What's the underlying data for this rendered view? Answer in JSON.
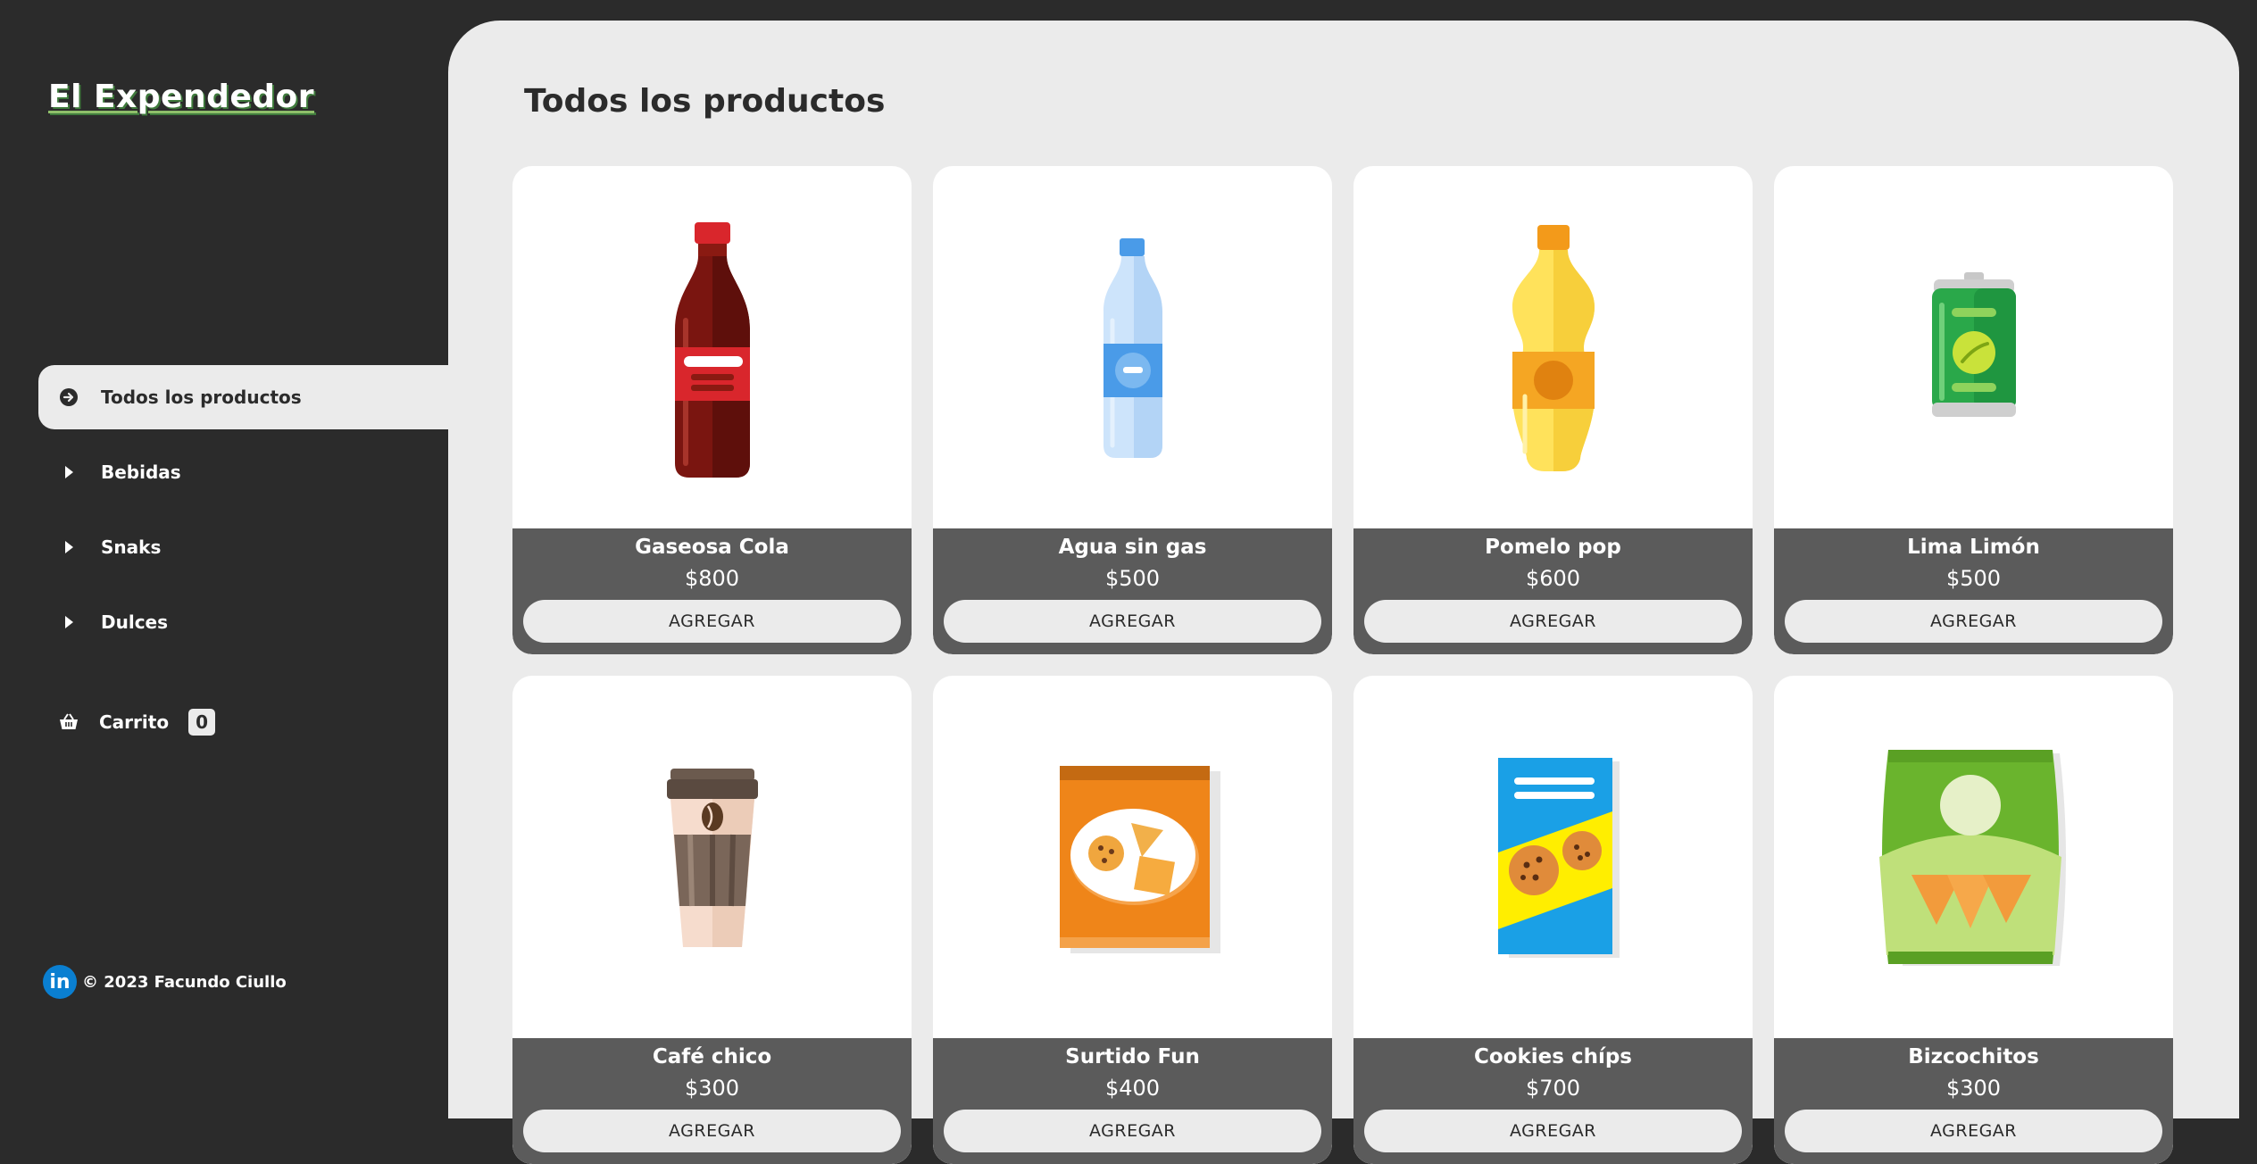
{
  "brand": {
    "title": "El Expendedor"
  },
  "sidebar": {
    "items": [
      {
        "label": "Todos los productos",
        "icon": "arrow-circle-right-icon",
        "active": true
      },
      {
        "label": "Bebidas",
        "icon": "caret-right-icon"
      },
      {
        "label": "Snaks",
        "icon": "caret-right-icon"
      },
      {
        "label": "Dulces",
        "icon": "caret-right-icon"
      }
    ],
    "cart": {
      "label": "Carrito",
      "count": "0",
      "icon": "basket-icon"
    },
    "footer": {
      "text": "© 2023 Facundo Ciullo",
      "icon": "linkedin-icon",
      "icon_glyph": "in"
    }
  },
  "main": {
    "title": "Todos los productos",
    "products": [
      {
        "name": "Gaseosa Cola",
        "price": "$800",
        "button": "AGREGAR",
        "icon": "cola-bottle-icon"
      },
      {
        "name": "Agua sin gas",
        "price": "$500",
        "button": "AGREGAR",
        "icon": "water-bottle-icon"
      },
      {
        "name": "Pomelo pop",
        "price": "$600",
        "button": "AGREGAR",
        "icon": "grapefruit-soda-bottle-icon"
      },
      {
        "name": "Lima Limón",
        "price": "$500",
        "button": "AGREGAR",
        "icon": "lime-can-icon"
      },
      {
        "name": "Café chico",
        "price": "$300",
        "button": "AGREGAR",
        "icon": "coffee-cup-icon"
      },
      {
        "name": "Surtido Fun",
        "price": "$400",
        "button": "AGREGAR",
        "icon": "assorted-crackers-box-icon"
      },
      {
        "name": "Cookies chíps",
        "price": "$700",
        "button": "AGREGAR",
        "icon": "cookies-box-icon"
      },
      {
        "name": "Bizcochitos",
        "price": "$300",
        "button": "AGREGAR",
        "icon": "snack-bag-icon"
      }
    ]
  },
  "colors": {
    "sidebar_bg": "#2b2b2b",
    "main_bg": "#ebebeb",
    "card_info_bg": "#5b5b5b",
    "accent_linkedin": "#0a7fd1"
  }
}
